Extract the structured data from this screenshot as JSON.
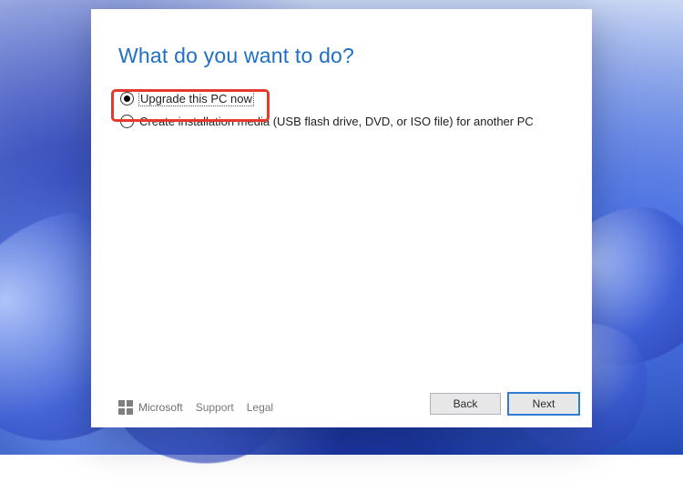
{
  "title": "What do you want to do?",
  "options": [
    {
      "label": "Upgrade this PC now",
      "selected": true
    },
    {
      "label": "Create installation media (USB flash drive, DVD, or ISO file) for another PC",
      "selected": false
    }
  ],
  "footer": {
    "brand": "Microsoft",
    "links": {
      "support": "Support",
      "legal": "Legal"
    },
    "buttons": {
      "back": "Back",
      "next": "Next"
    }
  },
  "colors": {
    "accent": "#1f6fc5",
    "highlight": "#e53a2b"
  }
}
